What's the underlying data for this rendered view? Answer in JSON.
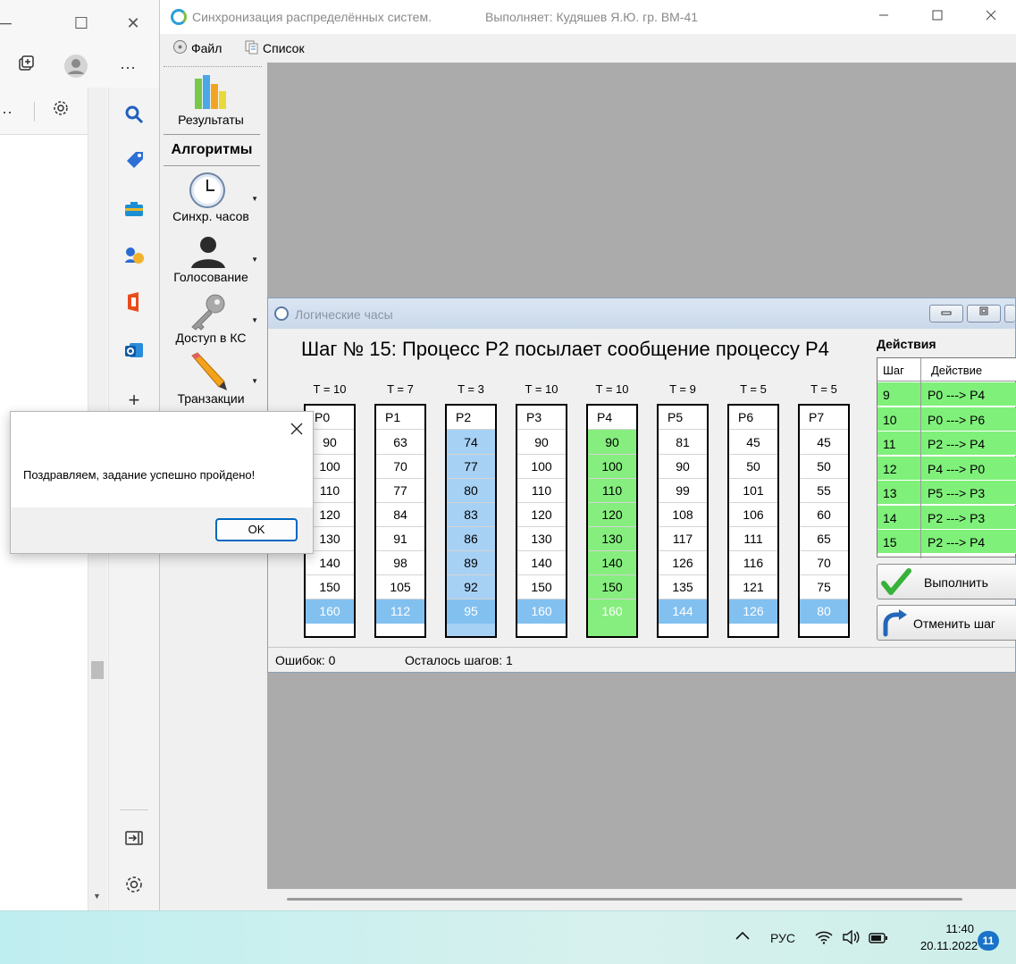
{
  "browser": {
    "close_glyph": "✕",
    "min_glyph": "─",
    "max_glyph": "☐",
    "more_glyph": "···",
    "more_glyph2": "···",
    "sidebar_add": "+"
  },
  "app": {
    "title": "Синхронизация распределённых систем.",
    "author": "Выполняет:  Кудяшев Я.Ю.  гр. ВМ-41",
    "menu": {
      "file": "Файл",
      "list": "Список"
    },
    "tools": {
      "results": "Результаты",
      "algorithms_header": "Алгоритмы",
      "clock_sync": "Синхр. часов",
      "voting": "Голосование",
      "cs_access": "Доступ в КС",
      "transactions": "Транзакции"
    }
  },
  "child_window": {
    "title": "Логические часы",
    "step_title": "Шаг № 15: Процесс P2 посылает сообщение процессу P4",
    "processes": [
      {
        "t": "T = 10",
        "name": "P0",
        "values": [
          "90",
          "100",
          "110",
          "120",
          "130",
          "140",
          "150",
          "160"
        ],
        "highlight": "none"
      },
      {
        "t": "T = 7",
        "name": "P1",
        "values": [
          "63",
          "70",
          "77",
          "84",
          "91",
          "98",
          "105",
          "112"
        ],
        "highlight": "none"
      },
      {
        "t": "T = 3",
        "name": "P2",
        "values": [
          "74",
          "77",
          "80",
          "83",
          "86",
          "89",
          "92",
          "95"
        ],
        "highlight": "blue"
      },
      {
        "t": "T = 10",
        "name": "P3",
        "values": [
          "90",
          "100",
          "110",
          "120",
          "130",
          "140",
          "150",
          "160"
        ],
        "highlight": "none"
      },
      {
        "t": "T = 10",
        "name": "P4",
        "values": [
          "90",
          "100",
          "110",
          "120",
          "130",
          "140",
          "150",
          "160"
        ],
        "highlight": "green"
      },
      {
        "t": "T = 9",
        "name": "P5",
        "values": [
          "81",
          "90",
          "99",
          "108",
          "117",
          "126",
          "135",
          "144"
        ],
        "highlight": "none"
      },
      {
        "t": "T = 5",
        "name": "P6",
        "values": [
          "45",
          "50",
          "101",
          "106",
          "111",
          "116",
          "121",
          "126"
        ],
        "highlight": "none"
      },
      {
        "t": "T = 5",
        "name": "P7",
        "values": [
          "45",
          "50",
          "55",
          "60",
          "65",
          "70",
          "75",
          "80"
        ],
        "highlight": "none"
      }
    ],
    "actions": {
      "title": "Действия",
      "col_step": "Шаг",
      "col_action": "Действие",
      "rows": [
        {
          "step": "9",
          "action": "P0 ---> P4"
        },
        {
          "step": "10",
          "action": "P0 ---> P6"
        },
        {
          "step": "11",
          "action": "P2 ---> P4"
        },
        {
          "step": "12",
          "action": "P4 ---> P0"
        },
        {
          "step": "13",
          "action": "P5 ---> P3"
        },
        {
          "step": "14",
          "action": "P2 ---> P3"
        },
        {
          "step": "15",
          "action": "P2 ---> P4"
        }
      ]
    },
    "execute_label": "Выполнить",
    "undo_label": "Отменить шаг",
    "status": {
      "errors": "Ошибок: 0",
      "remaining": "Осталось шагов: 1"
    }
  },
  "dialog": {
    "message": "Поздравляем, задание успешно пройдено!",
    "ok_label": "OK"
  },
  "taskbar": {
    "lang": "РУС",
    "time": "11:40",
    "date": "20.11.2022",
    "notifications": "11"
  }
}
